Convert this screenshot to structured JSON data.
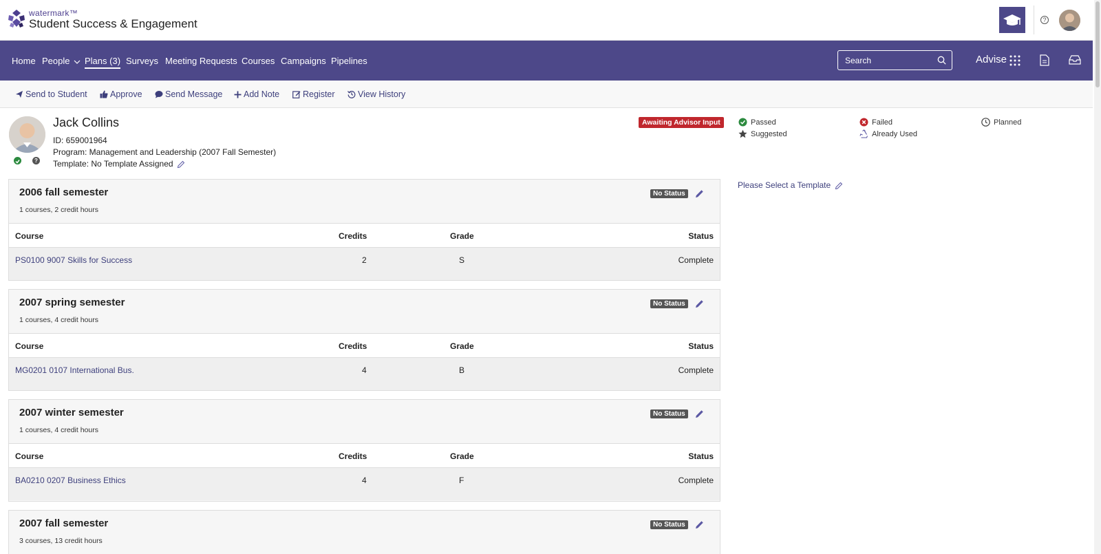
{
  "brand": {
    "small": "watermark™",
    "title": "Student Success & Engagement"
  },
  "nav": {
    "items": [
      "Home",
      "People",
      "Plans (3)",
      "Surveys",
      "Meeting Requests",
      "Courses",
      "Campaigns",
      "Pipelines"
    ],
    "active": "Plans (3)",
    "search_placeholder": "Search",
    "advise_label": "Advise"
  },
  "toolbar": {
    "send_to_student": "Send to Student",
    "approve": "Approve",
    "send_message": "Send Message",
    "add_note": "Add Note",
    "register": "Register",
    "view_history": "View History"
  },
  "student": {
    "name": "Jack Collins",
    "id_line": "ID: 659001964",
    "program_line": "Program: Management and Leadership (2007 Fall Semester)",
    "template_line": "Template: No Template Assigned",
    "status_badge": "Awaiting Advisor Input"
  },
  "legend": {
    "passed": "Passed",
    "failed": "Failed",
    "planned": "Planned",
    "suggested": "Suggested",
    "already_used": "Already Used"
  },
  "template_prompt": "Please Select a Template",
  "table_headers": {
    "course": "Course",
    "credits": "Credits",
    "grade": "Grade",
    "status": "Status"
  },
  "semesters": [
    {
      "title": "2006 fall semester",
      "summary": "1 courses, 2 credit hours",
      "status": "No Status",
      "courses": [
        {
          "course": "PS0100 9007 Skills for Success",
          "credits": "2",
          "grade": "S",
          "status": "Complete"
        }
      ]
    },
    {
      "title": "2007 spring semester",
      "summary": "1 courses, 4 credit hours",
      "status": "No Status",
      "courses": [
        {
          "course": "MG0201 0107 International Bus.",
          "credits": "4",
          "grade": "B",
          "status": "Complete"
        }
      ]
    },
    {
      "title": "2007 winter semester",
      "summary": "1 courses, 4 credit hours",
      "status": "No Status",
      "courses": [
        {
          "course": "BA0210 0207 Business Ethics",
          "credits": "4",
          "grade": "F",
          "status": "Complete"
        }
      ]
    },
    {
      "title": "2007 fall semester",
      "summary": "3 courses, 13 credit hours",
      "status": "No Status",
      "courses": []
    }
  ],
  "colors": {
    "nav_bg": "#4d4889",
    "link": "#3d3f7c",
    "awaiting_badge": "#c0272d",
    "no_status_badge": "#555555",
    "passed": "#2b8a3e",
    "failed": "#c0272d"
  }
}
